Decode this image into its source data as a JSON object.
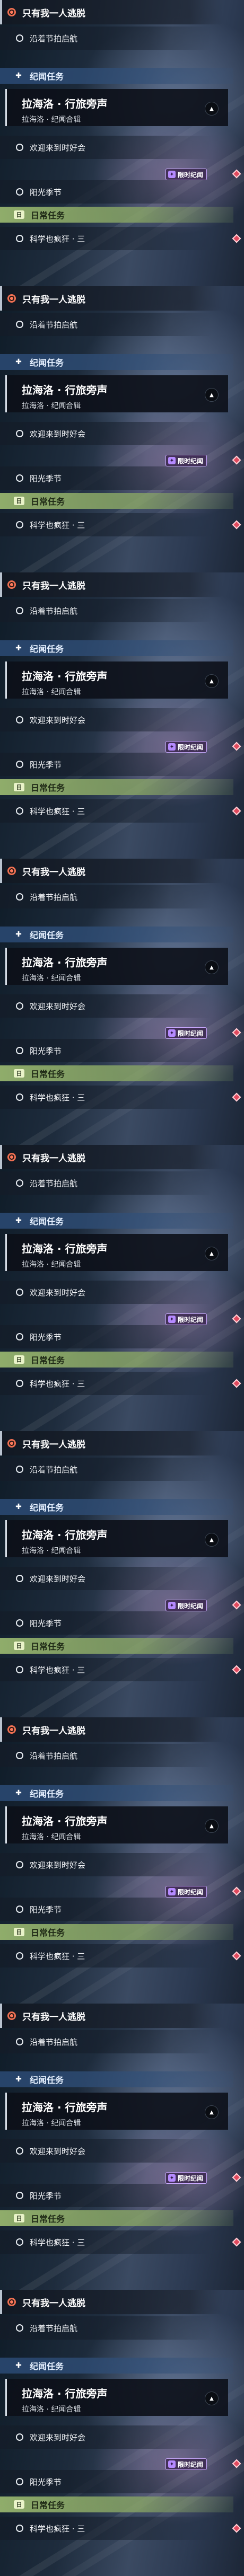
{
  "quest": {
    "top_quest": "只有我一人逃脱",
    "top_step": "沿着节拍启航",
    "category_story": "纪闻任务",
    "story_title": "拉海洛 · 行旅旁声",
    "story_subtitle": "拉海洛 · 纪闻合辑",
    "step_1": "欢迎来到时好会",
    "step_2": "阳光季节",
    "badge": "限时纪闻",
    "category_daily": "日常任务",
    "daily_step": "科学也疯狂 · 三"
  },
  "icons": {
    "top": "target-icon",
    "step": "circle-icon",
    "story_category": "plus-icon",
    "daily_category": "daily-icon",
    "collapse": "chevron-up-icon",
    "badge": "sparkle-icon",
    "edge": "diamond-marker-icon"
  },
  "colors": {
    "story_category": "#324f78",
    "daily_category": "#96b46e",
    "badge_border": "#c9a9ff",
    "target": "#f07052",
    "edge_marker": "#e04a5e"
  }
}
